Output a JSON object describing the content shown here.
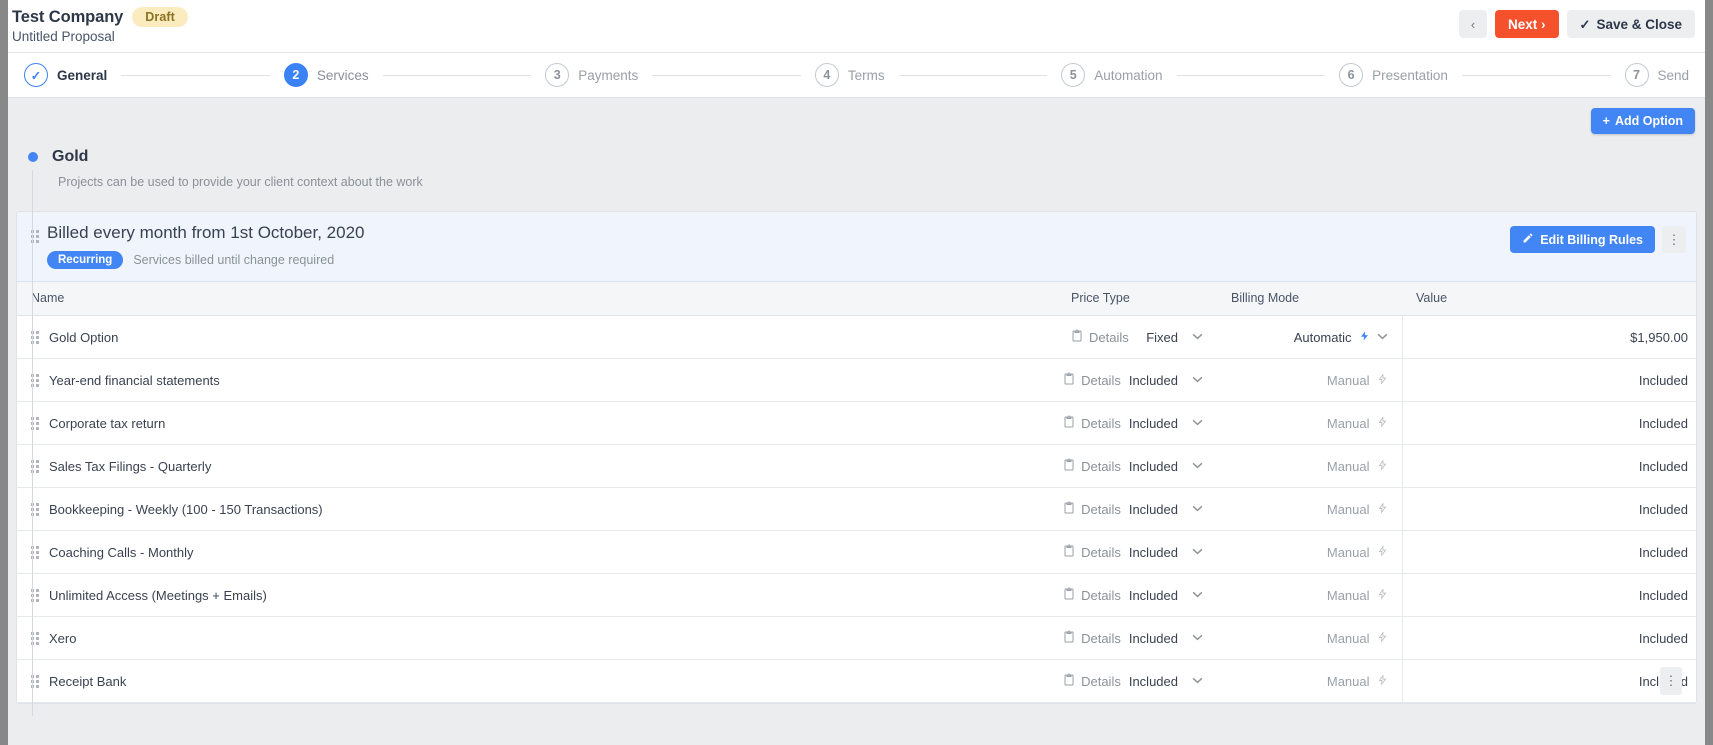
{
  "header": {
    "company": "Test Company",
    "status_badge": "Draft",
    "subtitle": "Untitled Proposal",
    "prev_label": "‹",
    "next_label": "Next ›",
    "save_label": "Save & Close",
    "accent_red": "#f4512c",
    "badge_bg": "#fbecc0"
  },
  "stepper": {
    "steps": [
      {
        "num": "✓",
        "label": "General",
        "state": "done"
      },
      {
        "num": "2",
        "label": "Services",
        "state": "active"
      },
      {
        "num": "3",
        "label": "Payments",
        "state": "todo"
      },
      {
        "num": "4",
        "label": "Terms",
        "state": "todo"
      },
      {
        "num": "5",
        "label": "Automation",
        "state": "todo"
      },
      {
        "num": "6",
        "label": "Presentation",
        "state": "todo"
      },
      {
        "num": "7",
        "label": "Send",
        "state": "todo"
      }
    ],
    "accent_blue": "#3b82f6"
  },
  "toolbar": {
    "add_option_label": "Add Option"
  },
  "option": {
    "name": "Gold",
    "description": "Projects can be used to provide your client context about the work",
    "dot_color": "#4285f4"
  },
  "billing": {
    "title": "Billed every month from 1st October, 2020",
    "badge": "Recurring",
    "meta": "Services billed until change required",
    "edit_label": "Edit Billing Rules",
    "kebab": "⋮"
  },
  "table": {
    "columns": [
      "Name",
      "Price Type",
      "Billing Mode",
      "Value"
    ],
    "details_label": "Details",
    "rows": [
      {
        "name": "Gold Option",
        "price_type": "Fixed",
        "billing_mode": "Automatic",
        "mode_state": "auto",
        "value": "$1,950.00"
      },
      {
        "name": "Year-end financial statements",
        "price_type": "Included",
        "billing_mode": "Manual",
        "mode_state": "manual",
        "value": "Included"
      },
      {
        "name": "Corporate tax return",
        "price_type": "Included",
        "billing_mode": "Manual",
        "mode_state": "manual",
        "value": "Included"
      },
      {
        "name": "Sales Tax Filings - Quarterly",
        "price_type": "Included",
        "billing_mode": "Manual",
        "mode_state": "manual",
        "value": "Included"
      },
      {
        "name": "Bookkeeping - Weekly (100 - 150 Transactions)",
        "price_type": "Included",
        "billing_mode": "Manual",
        "mode_state": "manual",
        "value": "Included"
      },
      {
        "name": "Coaching Calls - Monthly",
        "price_type": "Included",
        "billing_mode": "Manual",
        "mode_state": "manual",
        "value": "Included"
      },
      {
        "name": "Unlimited Access (Meetings + Emails)",
        "price_type": "Included",
        "billing_mode": "Manual",
        "mode_state": "manual",
        "value": "Included"
      },
      {
        "name": "Xero",
        "price_type": "Included",
        "billing_mode": "Manual",
        "mode_state": "manual",
        "value": "Included"
      },
      {
        "name": "Receipt Bank",
        "price_type": "Included",
        "billing_mode": "Manual",
        "mode_state": "manual",
        "value": "Included"
      }
    ],
    "row_kebab": "⋮"
  }
}
